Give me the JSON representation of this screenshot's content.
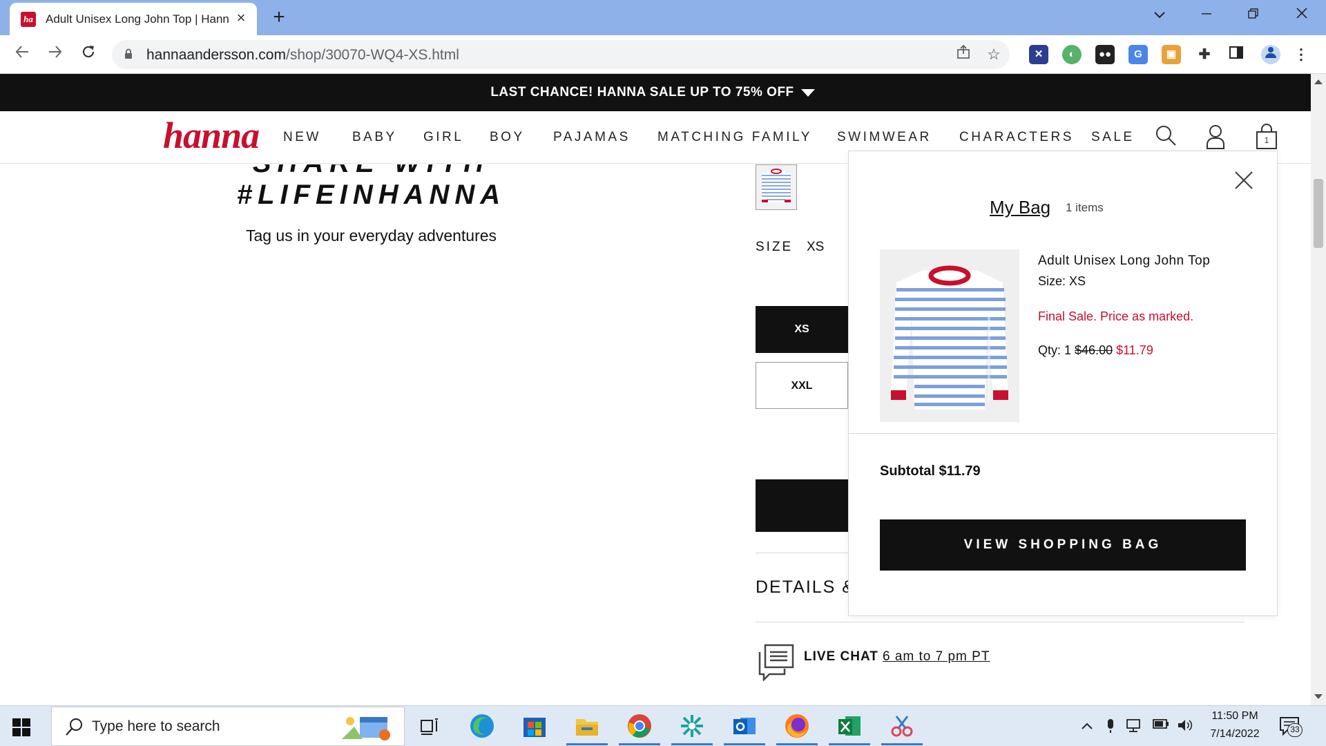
{
  "browser": {
    "tab_title": "Adult Unisex Long John Top | Hanna Andersson",
    "favicon_text": "ha",
    "url_domain": "hannaandersson.com",
    "url_path": "/shop/30070-WQ4-XS.html"
  },
  "site": {
    "promo_banner": "LAST CHANCE! HANNA SALE UP TO 75% OFF",
    "logo": "hanna",
    "nav": [
      "NEW",
      "BABY",
      "GIRL",
      "BOY",
      "PAJAMAS",
      "MATCHING FAMILY",
      "SWIMWEAR",
      "CHARACTERS",
      "SALE"
    ],
    "bag_count": "1",
    "brand_color": "#c8102e"
  },
  "share": {
    "title_line1": "SHARE WITH",
    "title_line2": "#LIFEINHANNA",
    "subtitle": "Tag us in your everyday adventures"
  },
  "product_panel": {
    "size_label": "SIZE",
    "size_selected": "XS",
    "size_options": [
      "XS",
      "XXL"
    ],
    "details_heading": "DETAILS &",
    "live_chat_label": "LIVE CHAT",
    "live_chat_hours": "6 am to 7 pm PT"
  },
  "mini_bag": {
    "title": "My Bag",
    "count": "1 items",
    "item": {
      "name": "Adult Unisex Long John Top",
      "size": "Size: XS",
      "sale_note": "Final Sale. Price as marked.",
      "qty": "Qty: 1",
      "original_price": "$46.00",
      "sale_price": "$11.79"
    },
    "subtotal": "Subtotal $11.79",
    "view_bag_button": "VIEW SHOPPING BAG"
  },
  "taskbar": {
    "search_placeholder": "Type here to search",
    "time": "11:50 PM",
    "date": "7/14/2022",
    "notification_count": "33"
  }
}
